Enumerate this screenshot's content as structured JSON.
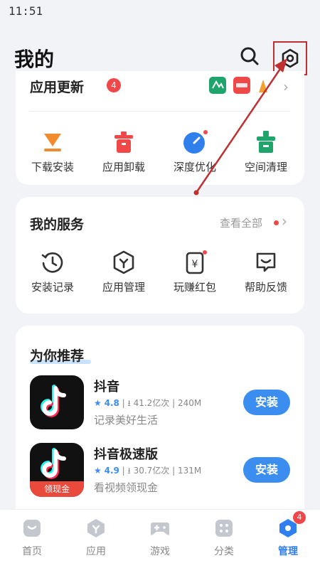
{
  "status_bar": {
    "time": "11:51"
  },
  "header": {
    "title": "我的"
  },
  "updates": {
    "title": "应用更新",
    "count": "4",
    "tools": [
      {
        "label": "下载安装",
        "icon": "download-icon",
        "color": "#f28a2e"
      },
      {
        "label": "应用卸载",
        "icon": "uninstall-icon",
        "color": "#f04848"
      },
      {
        "label": "深度优化",
        "icon": "optimize-icon",
        "color": "#2f80ed"
      },
      {
        "label": "空间清理",
        "icon": "cleanup-icon",
        "color": "#1fa46b"
      }
    ]
  },
  "services": {
    "title": "我的服务",
    "see_all": "查看全部",
    "items": [
      {
        "label": "安装记录",
        "icon": "history-icon"
      },
      {
        "label": "应用管理",
        "icon": "app-manage-icon"
      },
      {
        "label": "玩赚红包",
        "icon": "red-packet-icon"
      },
      {
        "label": "帮助反馈",
        "icon": "feedback-icon"
      }
    ]
  },
  "recommend": {
    "title": "为你推荐",
    "apps": [
      {
        "name": "抖音",
        "rating": "4.8",
        "downloads": "41.2亿次",
        "size": "240M",
        "desc": "记录美好生活",
        "button": "安装"
      },
      {
        "name": "抖音极速版",
        "rating": "4.9",
        "downloads": "30.7亿次",
        "size": "131M",
        "desc": "看视频领现金",
        "button": "安装",
        "banner": "领现金"
      }
    ]
  },
  "tabbar": {
    "tabs": [
      {
        "label": "首页",
        "icon": "home-icon"
      },
      {
        "label": "应用",
        "icon": "apps-icon"
      },
      {
        "label": "游戏",
        "icon": "gamepad-icon"
      },
      {
        "label": "分类",
        "icon": "category-icon"
      },
      {
        "label": "管理",
        "icon": "manage-icon",
        "active": true,
        "badge": "4"
      }
    ]
  },
  "colors": {
    "accent": "#2f7ff0",
    "badge": "#f04848",
    "annotation": "#c03030"
  }
}
